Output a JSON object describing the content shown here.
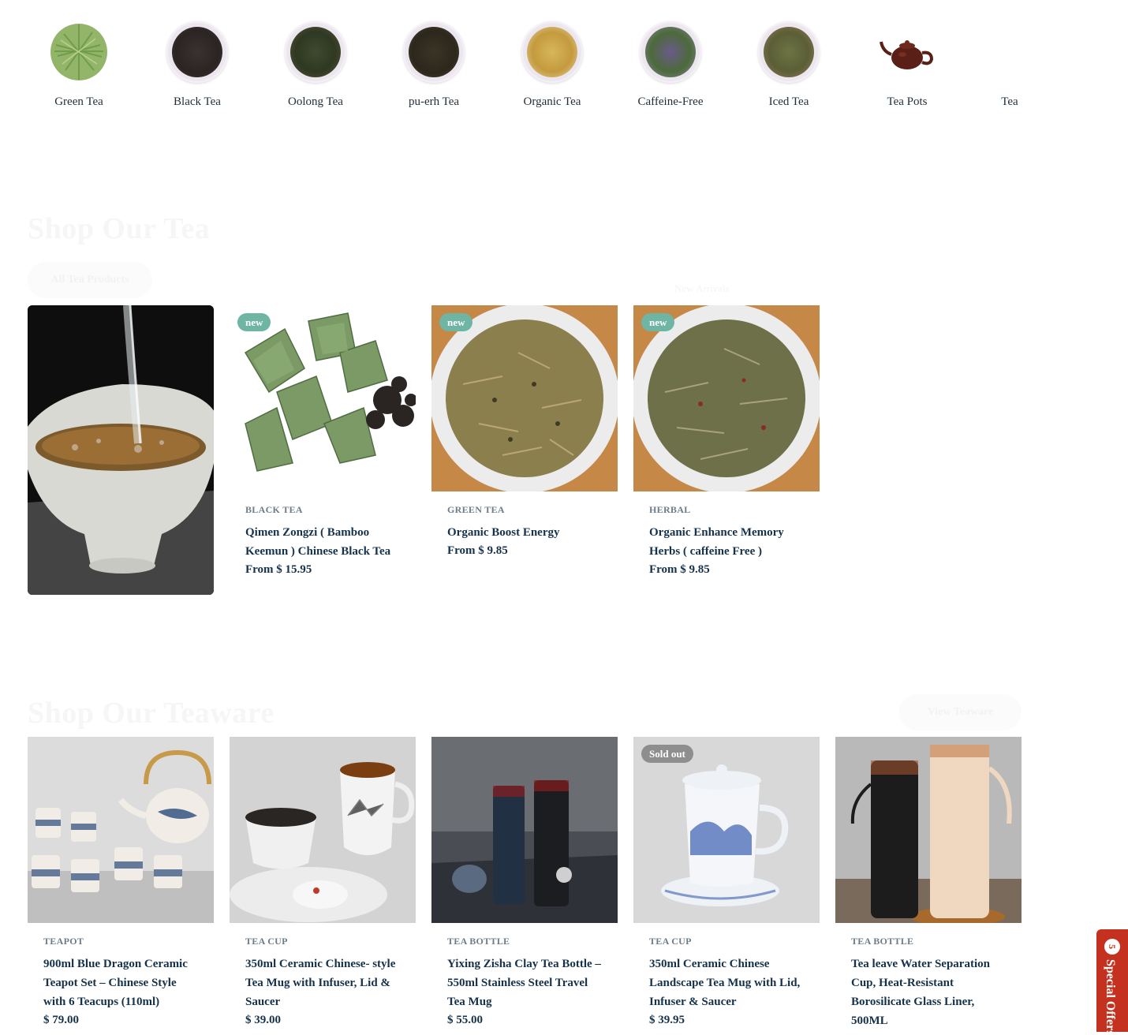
{
  "categories": [
    {
      "label": "Green Tea",
      "icon": "green-tea-leaves-icon"
    },
    {
      "label": "Black Tea",
      "icon": "black-tea-bowl-icon"
    },
    {
      "label": "Oolong Tea",
      "icon": "oolong-tea-bowl-icon"
    },
    {
      "label": "pu-erh Tea",
      "icon": "pu-erh-tea-bowl-icon"
    },
    {
      "label": "Organic Tea",
      "icon": "organic-tea-bowl-icon"
    },
    {
      "label": "Caffeine-Free",
      "icon": "caffeine-free-bowl-icon"
    },
    {
      "label": "Iced Tea",
      "icon": "iced-tea-bowl-icon"
    },
    {
      "label": "Tea Pots",
      "icon": "teapot-icon"
    },
    {
      "label": "Tea",
      "icon": "tea-bottle-icon"
    }
  ],
  "tea_section": {
    "title": "Shop Our Tea",
    "button": "All Tea Products",
    "link": "New Arrivals",
    "products": [
      {
        "badge": "new",
        "type": "BLACK TEA",
        "title": "Qimen Zongzi ( Bamboo Keemun ) Chinese Black Tea",
        "price": "From $ 15.95"
      },
      {
        "badge": "new",
        "type": "GREEN TEA",
        "title": "Organic Boost Energy",
        "price": "From $ 9.85"
      },
      {
        "badge": "new",
        "type": "HERBAL",
        "title": "Organic Enhance Memory Herbs ( caffeine Free )",
        "price": "From $ 9.85"
      }
    ]
  },
  "teaware_section": {
    "title": "Shop Our Teaware",
    "button": "View Teaware",
    "products": [
      {
        "badge": "",
        "type": "TEAPOT",
        "title": "900ml Blue Dragon Ceramic Teapot Set – Chinese Style with 6 Teacups (110ml)",
        "price": "$ 79.00"
      },
      {
        "badge": "",
        "type": "TEA CUP",
        "title": "350ml Ceramic Chinese- style Tea Mug with Infuser, Lid & Saucer",
        "price": "$ 39.00"
      },
      {
        "badge": "",
        "type": "TEA BOTTLE",
        "title": "Yixing Zisha Clay Tea Bottle – 550ml Stainless Steel Travel Tea Mug",
        "price": "$ 55.00"
      },
      {
        "badge": "Sold out",
        "type": "TEA CUP",
        "title": "350ml Ceramic Chinese Landscape Tea Mug with Lid, Infuser & Saucer",
        "price": "$ 39.95"
      },
      {
        "badge": "",
        "type": "TEA BOTTLE",
        "title": "Tea leave Water Separation Cup, Heat-Resistant Borosilicate Glass Liner, 500ML",
        "price": ""
      }
    ]
  },
  "offer": {
    "count": "5",
    "label": "Special Offers"
  },
  "colors": {
    "accent": "#6fb5a3",
    "offer": "#c4311f",
    "heading": "#15324a"
  }
}
